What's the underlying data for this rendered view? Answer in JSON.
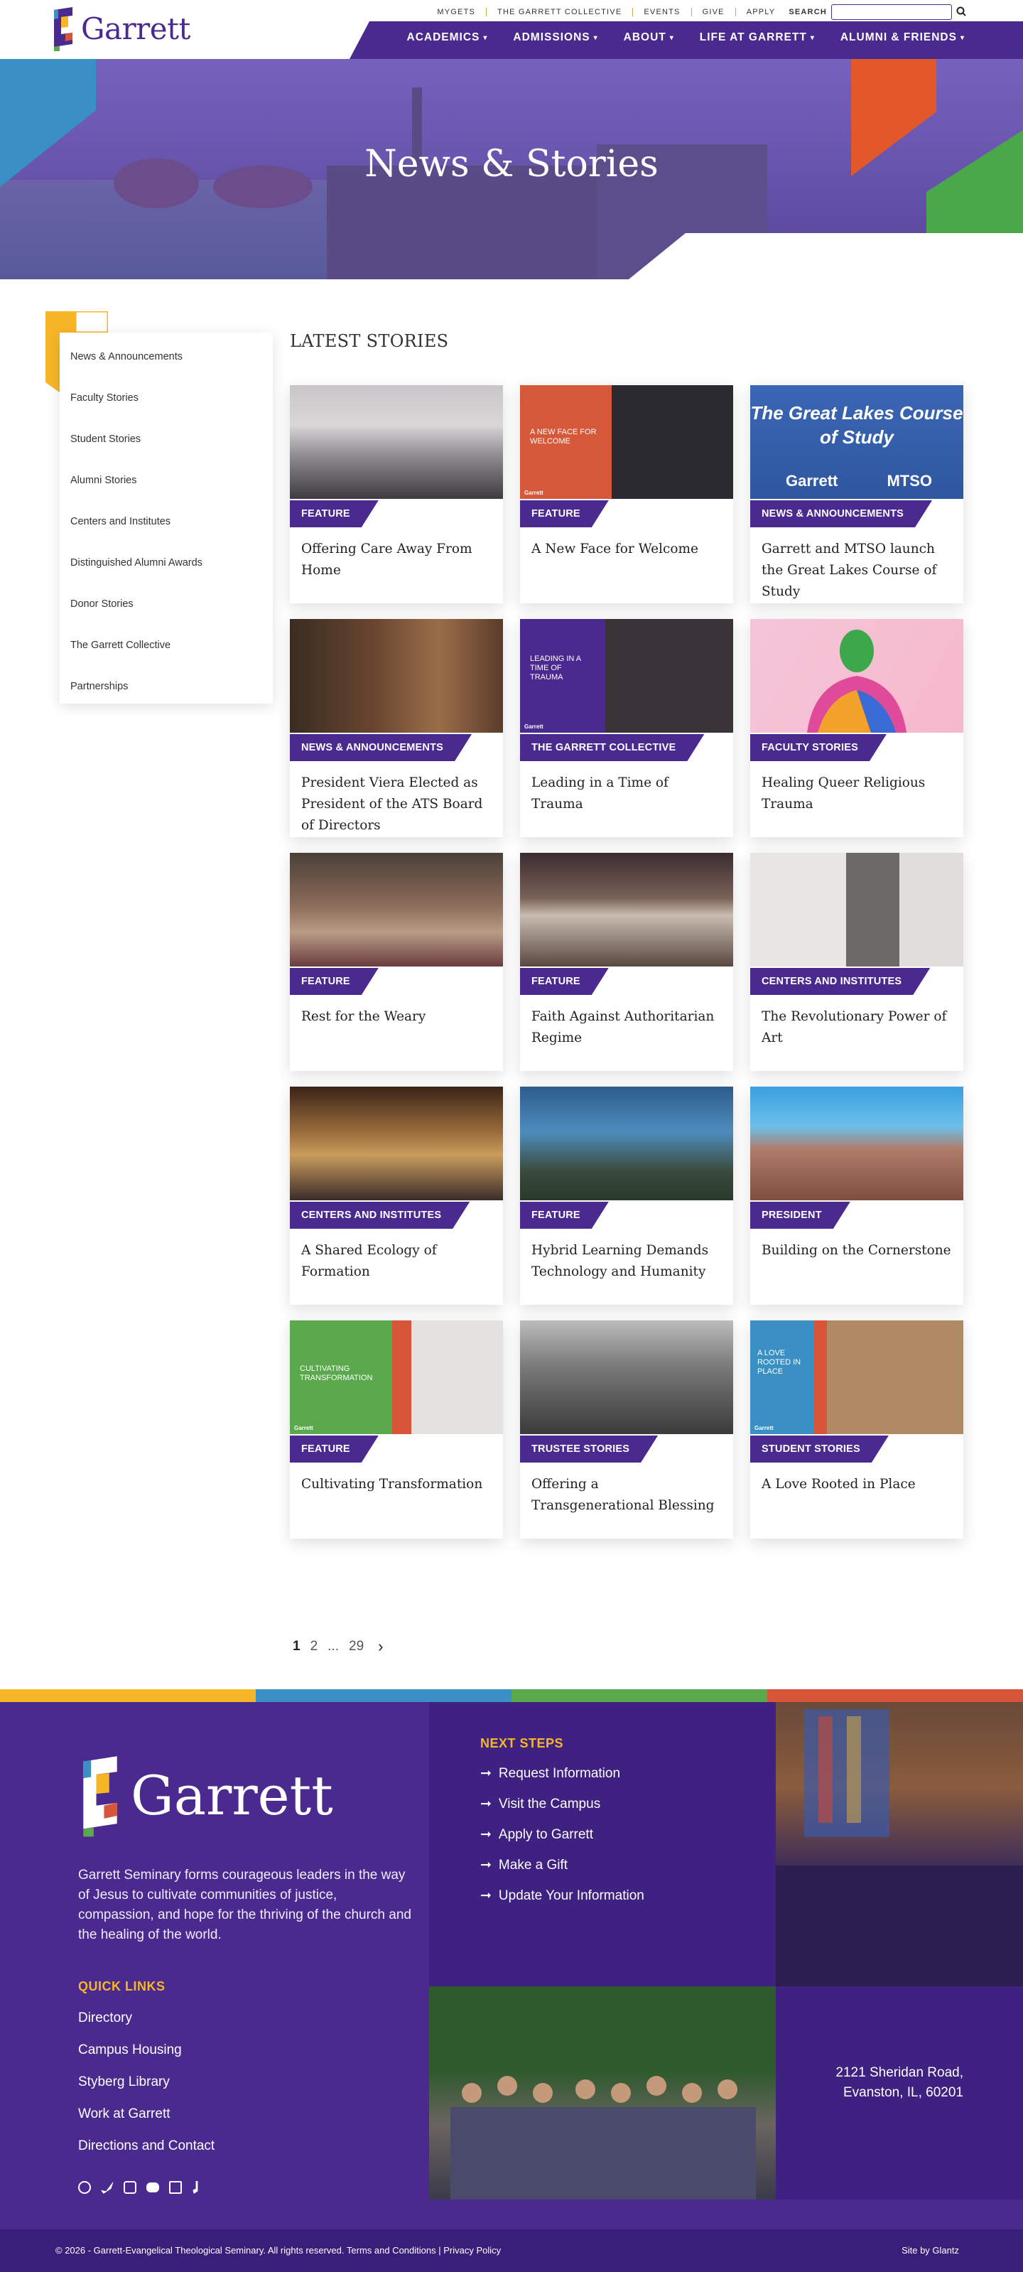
{
  "header": {
    "logo_text": "Garrett",
    "util_links": [
      "MYGETS",
      "THE GARRETT COLLECTIVE",
      "EVENTS",
      "GIVE",
      "APPLY"
    ],
    "search_label": "SEARCH",
    "search_placeholder": "",
    "nav": [
      "ACADEMICS",
      "ADMISSIONS",
      "ABOUT",
      "LIFE AT GARRETT",
      "ALUMNI & FRIENDS"
    ]
  },
  "hero": {
    "title": "News & Stories"
  },
  "sidebar": {
    "items": [
      {
        "label": "News & Announcements"
      },
      {
        "label": "Faculty Stories"
      },
      {
        "label": "Student Stories"
      },
      {
        "label": "Alumni Stories"
      },
      {
        "label": "Centers and Institutes"
      },
      {
        "label": "Distinguished Alumni Awards"
      },
      {
        "label": "Donor Stories"
      },
      {
        "label": "The Garrett Collective"
      },
      {
        "label": "Partnerships"
      }
    ]
  },
  "stories": {
    "title": "LATEST STORIES",
    "cards": [
      {
        "category": "FEATURE",
        "title": "Offering Care Away From Home",
        "image_caption": ""
      },
      {
        "category": "FEATURE",
        "title": "A New Face for Welcome",
        "image_caption": "A NEW FACE FOR WELCOME"
      },
      {
        "category": "NEWS & ANNOUNCEMENTS",
        "title": "Garrett and MTSO launch the Great Lakes Course of Study",
        "image_caption": "The Great Lakes Course of Study"
      },
      {
        "category": "NEWS & ANNOUNCEMENTS",
        "title": "President Viera Elected as President of the ATS Board of Directors",
        "image_caption": ""
      },
      {
        "category": "THE GARRETT COLLECTIVE",
        "title": "Leading in a Time of Trauma",
        "image_caption": "LEADING IN A TIME OF TRAUMA"
      },
      {
        "category": "FACULTY STORIES",
        "title": "Healing Queer Religious Trauma",
        "image_caption": ""
      },
      {
        "category": "FEATURE",
        "title": "Rest for the Weary",
        "image_caption": ""
      },
      {
        "category": "FEATURE",
        "title": "Faith Against Authoritarian Regime",
        "image_caption": ""
      },
      {
        "category": "CENTERS AND INSTITUTES",
        "title": "The Revolutionary Power of Art",
        "image_caption": ""
      },
      {
        "category": "CENTERS AND INSTITUTES",
        "title": "A Shared Ecology of Formation",
        "image_caption": ""
      },
      {
        "category": "FEATURE",
        "title": "Hybrid Learning Demands Technology and Humanity",
        "image_caption": ""
      },
      {
        "category": "PRESIDENT",
        "title": "Building on the Cornerstone",
        "image_caption": ""
      },
      {
        "category": "FEATURE",
        "title": "Cultivating Transformation",
        "image_caption": "CULTIVATING TRANSFORMATION"
      },
      {
        "category": "TRUSTEE STORIES",
        "title": "Offering a Transgenerational Blessing",
        "image_caption": ""
      },
      {
        "category": "STUDENT STORIES",
        "title": "A Love Rooted in Place",
        "image_caption": "A LOVE ROOTED IN PLACE"
      }
    ]
  },
  "pagination": {
    "pages": [
      "1",
      "2",
      "...",
      "29"
    ],
    "current": "1",
    "next": "›"
  },
  "footer": {
    "logo_text": "Garrett",
    "mission": "Garrett Seminary forms courageous leaders in the way of Jesus to cultivate communities of justice, compassion, and hope for the thriving of the church and the healing of the world.",
    "quick_links_title": "QUICK LINKS",
    "quick_links": [
      "Directory",
      "Campus Housing",
      "Styberg Library",
      "Work at Garrett",
      "Directions and Contact"
    ],
    "next_steps_title": "NEXT STEPS",
    "next_steps": [
      "Request Information",
      "Visit the Campus",
      "Apply to Garrett",
      "Make a Gift",
      "Update Your Information"
    ],
    "address_line1": "2121 Sheridan Road,",
    "address_line2": "Evanston, IL, 60201",
    "copyright": "© 2026 - Garrett-Evangelical Theological Seminary. All rights reserved. Terms and Conditions | Privacy Policy",
    "site_by": "Site by Glantz",
    "social": [
      "facebook-icon",
      "twitter-icon",
      "instagram-icon",
      "youtube-icon",
      "linkedin-icon",
      "tiktok-icon"
    ]
  },
  "colors": {
    "purple": "#4a2a8f",
    "gold": "#f6b627",
    "blue": "#3a8fc4",
    "green": "#5ba94d",
    "orange": "#d9553a"
  }
}
